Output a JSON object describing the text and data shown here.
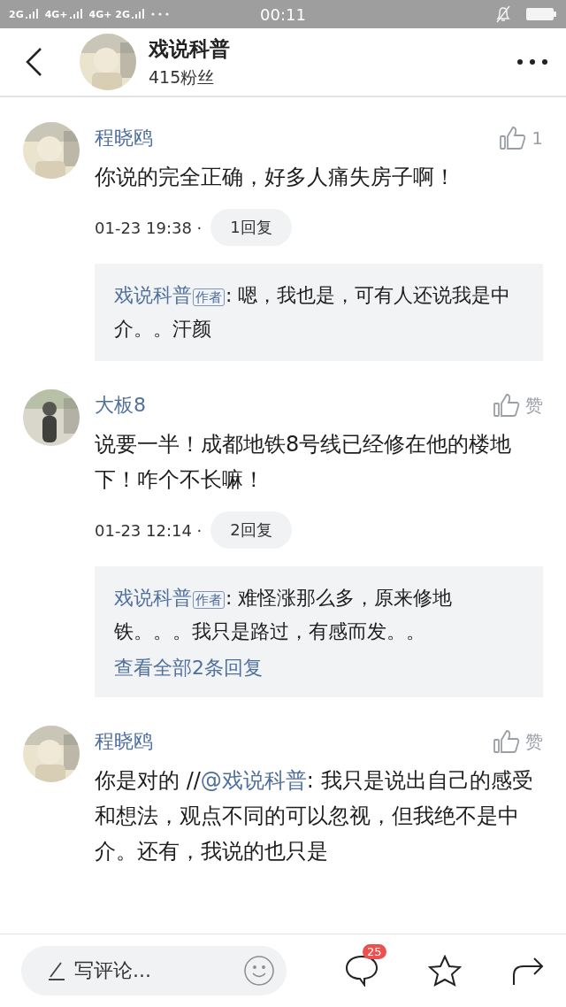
{
  "status_bar": {
    "signal_labels": [
      "2G",
      "4G+",
      "4G+ 2G"
    ],
    "time": "00:11"
  },
  "header": {
    "title": "戏说科普",
    "subtitle": "415粉丝"
  },
  "comments": [
    {
      "author": "程晓鸥",
      "like_label": "1",
      "body": [
        {
          "kind": "text",
          "text": "你说的完全正确，好多人痛失房子啊！"
        }
      ],
      "time": "01-23 19:38 ·",
      "reply_count": "1回复",
      "replies": [
        {
          "author": "戏说科普",
          "badge": "作者",
          "text": ": 嗯，我也是，可有人还说我是中介。。汗颜"
        }
      ]
    },
    {
      "author": "大板8",
      "like_label": "赞",
      "body": [
        {
          "kind": "text",
          "text": "说要一半！成都地铁8号线已经修在他的楼地下！咋个不长嘛！"
        }
      ],
      "time": "01-23 12:14 ·",
      "reply_count": "2回复",
      "replies": [
        {
          "author": "戏说科普",
          "badge": "作者",
          "text": ": 难怪涨那么多，原来修地铁。。。我只是路过，有感而发。。"
        }
      ],
      "more_link": "查看全部2条回复"
    },
    {
      "author": "程晓鸥",
      "like_label": "赞",
      "body": [
        {
          "kind": "text",
          "text": "你是对的 //"
        },
        {
          "kind": "mention",
          "text": "@戏说科普"
        },
        {
          "kind": "text",
          "text": ": 我只是说出自己的感受和想法，观点不同的可以忽视，但我绝不是中介。还有，我说的也只是"
        }
      ]
    }
  ],
  "bottom_bar": {
    "placeholder": "写评论...",
    "comment_badge": "25"
  }
}
